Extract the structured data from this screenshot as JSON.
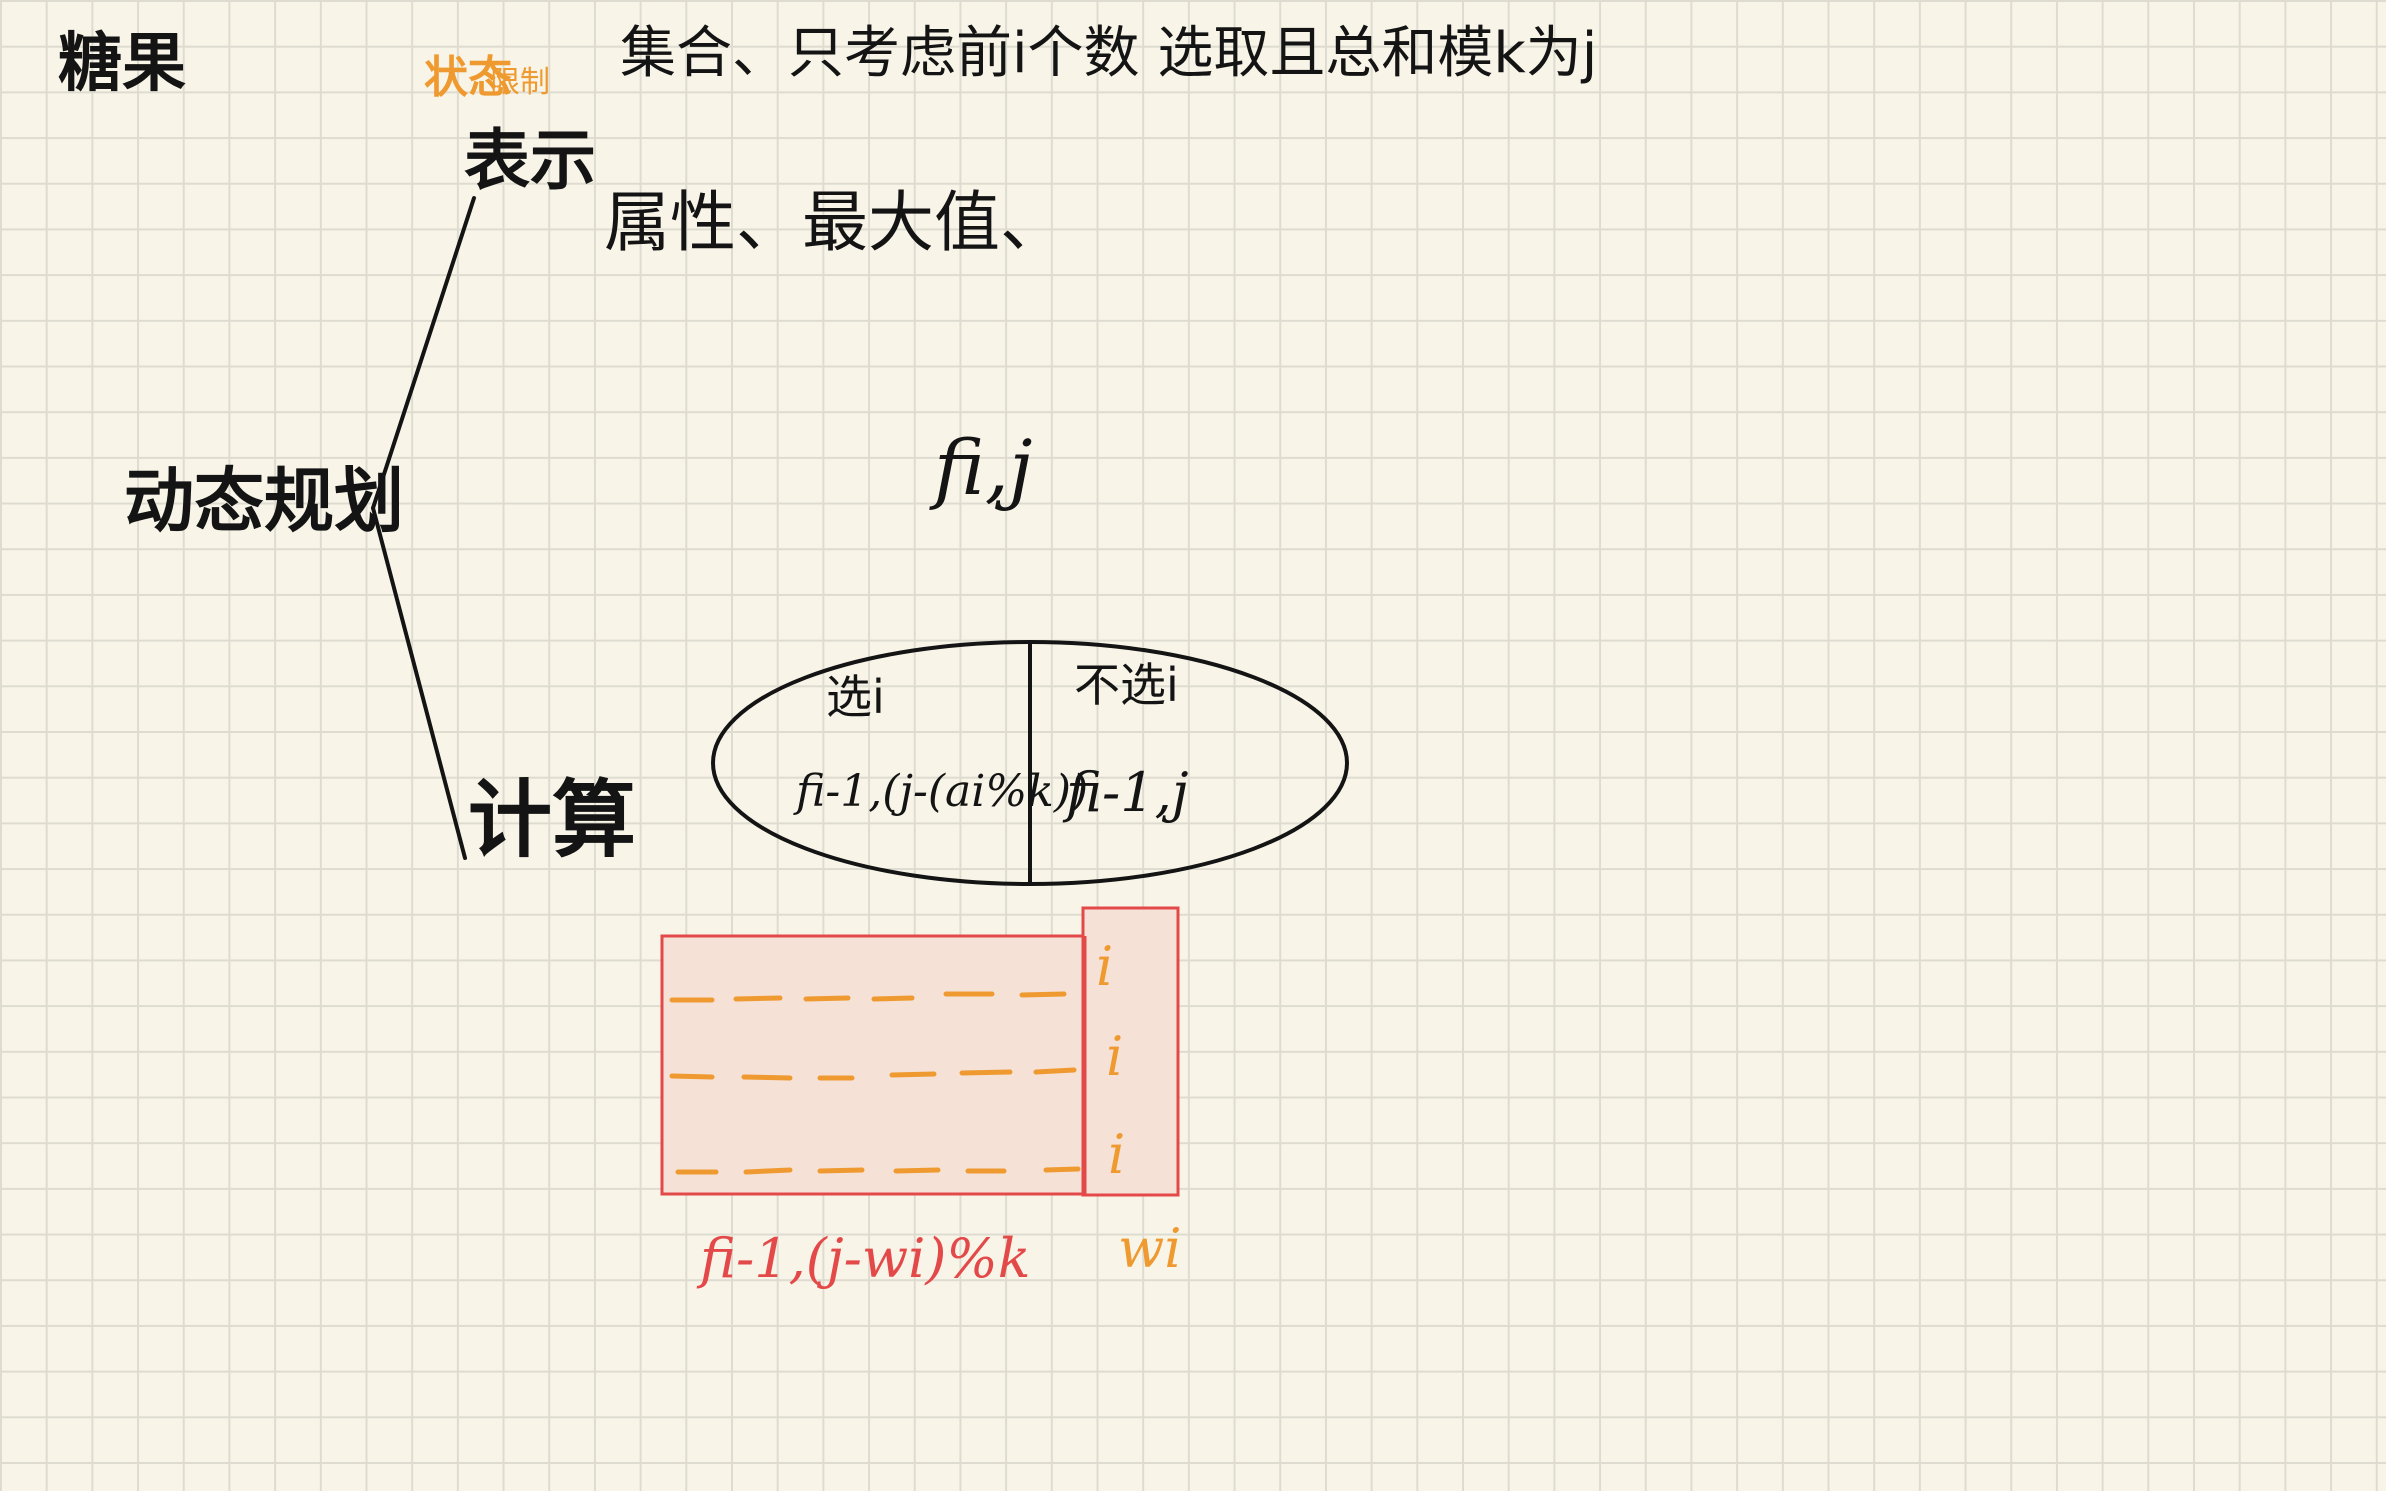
{
  "title": "糖果",
  "branch_root": "动态规划",
  "representation": {
    "annotation_main": "状态",
    "annotation_sub": "限制",
    "label": "表示",
    "set_text": "集合、只考虑前i个数 选取且总和模k为j",
    "property_text": "属性、最大值、"
  },
  "calculation": {
    "label": "计算"
  },
  "state_symbol": "fi,j",
  "partition": {
    "choose_label": "选i",
    "skip_label": "不选i",
    "choose_formula": "fi-1,(j-(ai%k))",
    "skip_formula": "fi-1,j"
  },
  "grid_demo": {
    "rows": 3,
    "item_marker": "i",
    "left_caption": "fi-1,(j-wi)%k",
    "right_caption": "wi"
  },
  "colors": {
    "background": "#f8f5e8",
    "grid_line": "#dedcd0",
    "ink": "#141414",
    "orange": "#ef9a30",
    "red": "#e4494a",
    "pink_fill": "#f6e1d6"
  }
}
